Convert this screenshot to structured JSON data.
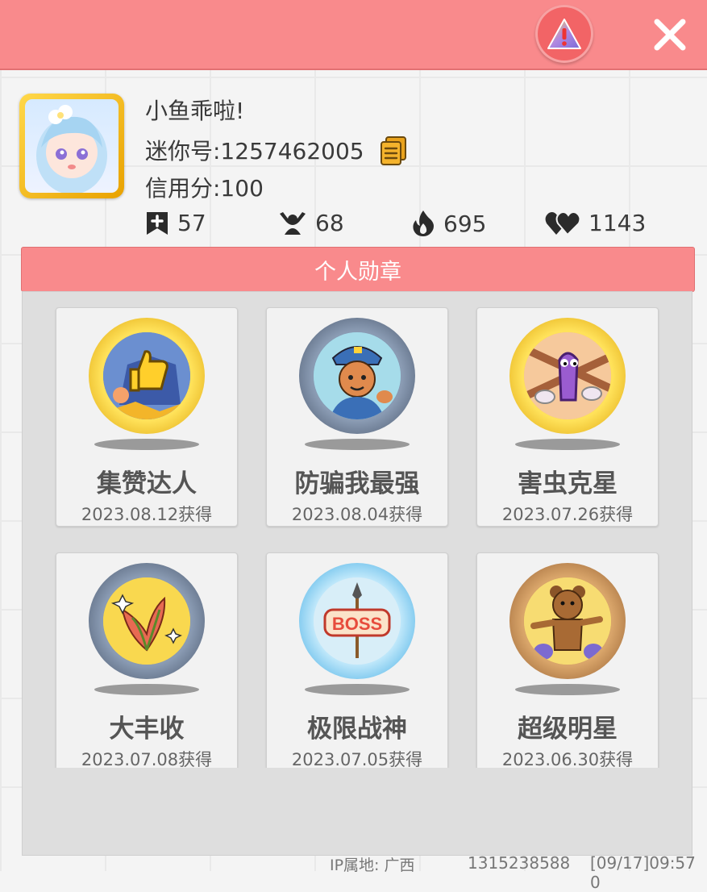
{
  "profile": {
    "username": "小鱼乖啦!",
    "mini_id": "迷你号:1257462005",
    "credit": "信用分:100"
  },
  "stats": [
    {
      "icon": "bookmark-plus-icon",
      "value": "57"
    },
    {
      "icon": "cheer-person-icon",
      "value": "68"
    },
    {
      "icon": "flame-icon",
      "value": "695"
    },
    {
      "icon": "heart-icon",
      "value": "1143"
    }
  ],
  "section": {
    "title": "个人勋章"
  },
  "medals": [
    {
      "name": "集赞达人",
      "date": "2023.08.12获得",
      "frame": "gold",
      "icon": "thumbs-up-medal-icon"
    },
    {
      "name": "防骗我最强",
      "date": "2023.08.04获得",
      "frame": "steel",
      "icon": "police-medal-icon"
    },
    {
      "name": "害虫克星",
      "date": "2023.07.26获得",
      "frame": "gold",
      "icon": "bug-medal-icon"
    },
    {
      "name": "大丰收",
      "date": "2023.07.08获得",
      "frame": "steel",
      "icon": "harvest-medal-icon"
    },
    {
      "name": "极限战神",
      "date": "2023.07.05获得",
      "frame": "crystal",
      "icon": "boss-medal-icon"
    },
    {
      "name": "超级明星",
      "date": "2023.06.30获得",
      "frame": "wood",
      "icon": "star-bear-medal-icon"
    }
  ],
  "footer": {
    "ip": "IP属地: 广西",
    "uid": "1315238588",
    "timestamp": "[09/17]09:57 0"
  },
  "colors": {
    "accent": "#f98a8c",
    "gold": "#f2b800",
    "steel": "#5f6f86",
    "crystal": "#7fd0f0",
    "wood": "#b07a45"
  }
}
